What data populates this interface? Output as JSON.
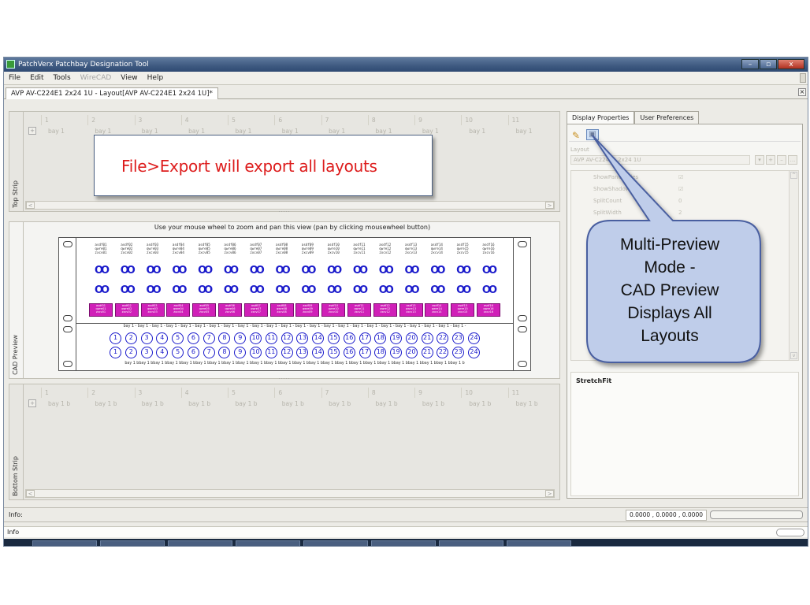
{
  "window": {
    "title": "PatchVerx Patchbay Designation Tool",
    "buttons": [
      "–",
      "▫",
      "x"
    ]
  },
  "menu": [
    "File",
    "Edit",
    "Tools",
    "WireCAD",
    "View",
    "Help"
  ],
  "document_tab": "AVP AV-C224E1 2x24 1U - Layout[AVP AV-C224E1 2x24 1U]*",
  "top_strip": {
    "label": "Top Strip",
    "columns": [
      "1",
      "2",
      "3",
      "4",
      "5",
      "6",
      "7",
      "8",
      "9",
      "10",
      "11"
    ],
    "cells": [
      "bay 1",
      "bay 1",
      "bay 1",
      "bay 1",
      "bay 1",
      "bay 1",
      "bay 1",
      "bay 1",
      "bay 1",
      "bay 1",
      "bay 1"
    ]
  },
  "cad_preview": {
    "label": "CAD Preview",
    "hint": "Use your mouse wheel to zoom and pan this view (pan by clicking mousewheel button)",
    "upper_labels": [
      [
        "asdf01",
        "qwre01",
        "zxcv01"
      ],
      [
        "asdf02",
        "qwre02",
        "zxcv02"
      ],
      [
        "asdf03",
        "qwre03",
        "zxcv03"
      ],
      [
        "asdf04",
        "qwre04",
        "zxcv04"
      ],
      [
        "asdf05",
        "qwre05",
        "zxcv05"
      ],
      [
        "asdf06",
        "qwre06",
        "zxcv06"
      ],
      [
        "asdf07",
        "qwre07",
        "zxcv07"
      ],
      [
        "asdf08",
        "qwre08",
        "zxcv08"
      ],
      [
        "asdf09",
        "qwre09",
        "zxcv09"
      ],
      [
        "asdf10",
        "qwre10",
        "zxcv10"
      ],
      [
        "asdf11",
        "qwre11",
        "zxcv11"
      ],
      [
        "asdf12",
        "qwre12",
        "zxcv12"
      ],
      [
        "asdf13",
        "qwre13",
        "zxcv13"
      ],
      [
        "asdf14",
        "qwre14",
        "zxcv14"
      ],
      [
        "asdf15",
        "qwre15",
        "zxcv15"
      ],
      [
        "asdf16",
        "qwre16",
        "zxcv16"
      ]
    ],
    "jack_glyph": "OO",
    "top_bay_row": "bay 1 - bay 1 - bay 1 - bay 1 - bay 1 - bay 1 - bay 1 - bay 1 - bay 1 - bay 1 - bay 1 - bay 1 - bay 1 - bay 1 - bay 1 - bay 1 - bay 1 - bay 1 - bay 1 - bay 1 - bay 1 - bay 1 - bay 1 - bay 1 -",
    "numbers": [
      "1",
      "2",
      "3",
      "4",
      "5",
      "6",
      "7",
      "8",
      "9",
      "10",
      "11",
      "12",
      "13",
      "14",
      "15",
      "16",
      "17",
      "18",
      "19",
      "20",
      "21",
      "22",
      "23",
      "24"
    ],
    "bottom_bay_row": "bay 1 bbay 1 bbay 1 bbay 1 bbay 1 bbay 1 bbay 1 bbay 1 bbay 1 bbay 1 bbay 1 bbay 1 bbay 1 bbay 1 bbay 1 bbay 1 bbay 1 bbay 1 bbay 1 bbay 1 bbay 1 bbay 1 bbay 1 bbay 1 b"
  },
  "bottom_strip": {
    "label": "Bottom Strip",
    "columns": [
      "1",
      "2",
      "3",
      "4",
      "5",
      "6",
      "7",
      "8",
      "9",
      "10",
      "11"
    ],
    "cells": [
      "bay 1 b",
      "bay 1 b",
      "bay 1 b",
      "bay 1 b",
      "bay 1 b",
      "bay 1 b",
      "bay 1 b",
      "bay 1 b",
      "bay 1 b",
      "bay 1 b",
      "bay 1 b"
    ]
  },
  "right_panel": {
    "tabs": [
      "Display Properties",
      "User Preferences"
    ],
    "layout_label": "Layout",
    "layout_value": "AVP AV-C224E1 2x24 1U",
    "layout_buttons": [
      "▾",
      "+",
      "–",
      "..."
    ],
    "properties": [
      {
        "name": "ShowPanelHoles",
        "value": "☑"
      },
      {
        "name": "ShowShadows",
        "value": "☑"
      },
      {
        "name": "SplitCount",
        "value": "0"
      },
      {
        "name": "SplitWidth",
        "value": "2"
      }
    ],
    "description_title": "StretchFit"
  },
  "status": {
    "info_label": "Info:",
    "coords": "0.0000 , 0.0000 , 0.0000",
    "info_panel_label": "Info"
  },
  "callouts": {
    "export_note": "File>Export will export all layouts",
    "multi_preview_lines": [
      "Multi-Preview",
      "Mode -",
      "CAD Preview",
      "Displays All",
      "Layouts"
    ]
  },
  "colors": {
    "callout_text_red": "#dd1c1c",
    "jack_blue": "#1a1acb",
    "designation_magenta": "#d020b8",
    "callout_bubble_fill": "#bfcdea",
    "callout_bubble_stroke": "#4a5fa0"
  }
}
